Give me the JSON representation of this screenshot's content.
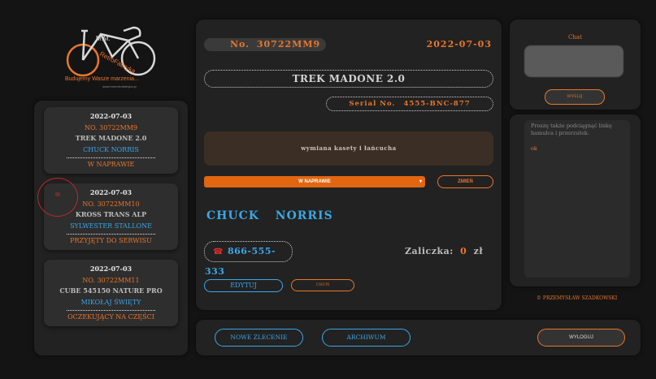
{
  "logo": {
    "brand_top": "M.M.",
    "brand_name": "RetroFabryka",
    "tagline": "Budujemy Wasze marzenia...",
    "url": "www.mmretrofabryka.pl"
  },
  "sidebar": {
    "orders": [
      {
        "date": "2022-07-03",
        "number": "NO. 30722MM9",
        "model": "TREK MADONE 2.0",
        "client": "CHUCK NORRIS",
        "status": "W NAPRAWIE"
      },
      {
        "date": "2022-07-03",
        "number": "NO. 30722MM10",
        "model": "KROSS TRANS ALP",
        "client": "SYLWESTER STALLONE",
        "status": "PRZYJĘTY DO SERWISU"
      },
      {
        "date": "2022-07-03",
        "number": "NO. 30722MM11",
        "model": "CUBE 545150 NATURE PRO",
        "client": "MIKOŁAJ ŚWIĘTY",
        "status": "OCZEKUJĄCY NA CZĘŚCI"
      }
    ],
    "cursor_glyph": "✉"
  },
  "order": {
    "number_label": "No.",
    "number": "30722MM9",
    "date": "2022-07-03",
    "model": "TREK MADONE 2.0",
    "serial_label": "Serial No.",
    "serial": "4555-BNC-877",
    "description": "wymiana kasety i łańcucha",
    "status": "W NAPRAWIE",
    "change_button": "ZMIEŃ",
    "client_first": "CHUCK",
    "client_last": "NORRIS",
    "phone_icon": "☎",
    "phone": "866-555-333",
    "deposit_label": "Zaliczka:",
    "deposit_value": "0",
    "deposit_currency": "zł",
    "edit_button": "EDYTUJ",
    "delete_button": "USUŃ"
  },
  "chat": {
    "title": "Chat",
    "send_button": "WYŚLIJ",
    "messages": [
      {
        "text": "Proszę także podciągnąć linkę hamulca i przerzutek.",
        "color": "#8a8a8a"
      },
      {
        "text": "ok",
        "color": "#e8762b"
      }
    ]
  },
  "footer": {
    "copyright": "© PRZEMYSŁAW SZADKOWSKI",
    "new_order": "NOWE ZLECENIE",
    "archive": "ARCHIWUM",
    "logout": "WYLOGUJ"
  },
  "colors": {
    "accent_orange": "#e8762b",
    "accent_blue": "#3ba6e6",
    "background": "#141414",
    "panel": "#222222"
  }
}
